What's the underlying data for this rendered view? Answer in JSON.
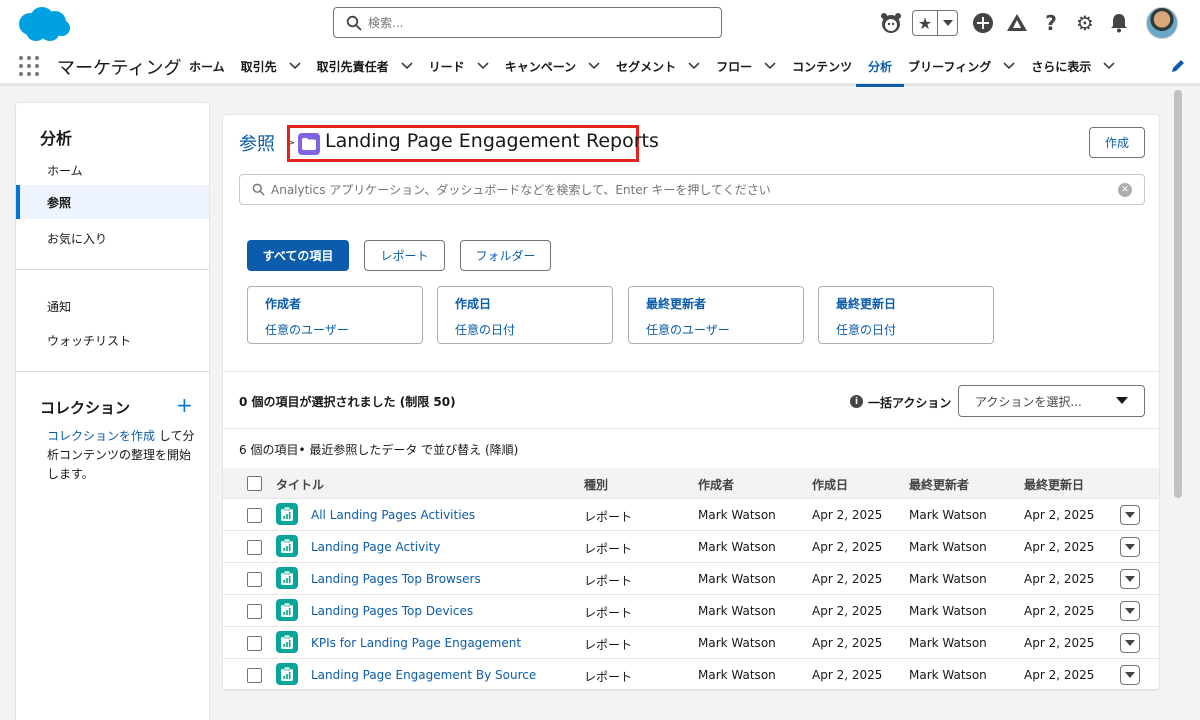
{
  "header": {
    "search_placeholder": "検索...",
    "icons": [
      "einstein-icon",
      "favorites-star-icon",
      "add-icon",
      "trailhead-icon",
      "help-icon",
      "setup-gear-icon",
      "notification-bell-icon"
    ]
  },
  "nav": {
    "app_name": "マーケティング",
    "items": [
      {
        "label": "ホーム",
        "dropdown": false
      },
      {
        "label": "取引先",
        "dropdown": true
      },
      {
        "label": "取引先責任者",
        "dropdown": true
      },
      {
        "label": "リード",
        "dropdown": true
      },
      {
        "label": "キャンペーン",
        "dropdown": true
      },
      {
        "label": "セグメント",
        "dropdown": true
      },
      {
        "label": "フロー",
        "dropdown": true
      },
      {
        "label": "コンテンツ",
        "dropdown": false
      },
      {
        "label": "分析",
        "dropdown": false,
        "active": true
      },
      {
        "label": "ブリーフィング",
        "dropdown": true
      },
      {
        "label": "さらに表示",
        "dropdown": true
      }
    ]
  },
  "sidebar": {
    "title": "分析",
    "items": [
      {
        "label": "ホーム"
      },
      {
        "label": "参照",
        "selected": true
      },
      {
        "label": "お気に入り"
      },
      {
        "label": "通知"
      },
      {
        "label": "ウォッチリスト"
      }
    ],
    "collections": {
      "title": "コレクション",
      "link_text": "コレクションを作成",
      "text": "して分析コンテンツの整理を開始します。"
    }
  },
  "main": {
    "breadcrumb": "参照",
    "folder_title": "Landing Page Engagement Reports",
    "create_label": "作成",
    "search_placeholder": "Analytics アプリケーション、ダッシュボードなどを検索して、Enter キーを押してください",
    "filter_buttons": [
      "すべての項目",
      "レポート",
      "フォルダー"
    ],
    "filter_cards": [
      {
        "title": "作成者",
        "value": "任意のユーザー"
      },
      {
        "title": "作成日",
        "value": "任意の日付"
      },
      {
        "title": "最終更新者",
        "value": "任意のユーザー"
      },
      {
        "title": "最終更新日",
        "value": "任意の日付"
      }
    ],
    "selection_status": "0 個の項目が選択されました (制限 50)",
    "bulk_action_label": "一括アクション",
    "action_select_placeholder": "アクションを選択...",
    "sort_info": "6 個の項目• 最近参照したデータ で並び替え (降順)",
    "table": {
      "columns": [
        "タイトル",
        "種別",
        "作成者",
        "作成日",
        "最終更新者",
        "最終更新日"
      ],
      "rows": [
        {
          "title": "All Landing Pages Activities",
          "type": "レポート",
          "created_by": "Mark Watson",
          "created_date": "Apr 2, 2025",
          "modified_by": "Mark Watson",
          "modified_date": "Apr 2, 2025"
        },
        {
          "title": "Landing Page Activity",
          "type": "レポート",
          "created_by": "Mark Watson",
          "created_date": "Apr 2, 2025",
          "modified_by": "Mark Watson",
          "modified_date": "Apr 2, 2025"
        },
        {
          "title": "Landing Pages Top Browsers",
          "type": "レポート",
          "created_by": "Mark Watson",
          "created_date": "Apr 2, 2025",
          "modified_by": "Mark Watson",
          "modified_date": "Apr 2, 2025"
        },
        {
          "title": "Landing Pages Top Devices",
          "type": "レポート",
          "created_by": "Mark Watson",
          "created_date": "Apr 2, 2025",
          "modified_by": "Mark Watson",
          "modified_date": "Apr 2, 2025"
        },
        {
          "title": "KPIs for Landing Page Engagement",
          "type": "レポート",
          "created_by": "Mark Watson",
          "created_date": "Apr 2, 2025",
          "modified_by": "Mark Watson",
          "modified_date": "Apr 2, 2025"
        },
        {
          "title": "Landing Page Engagement By Source",
          "type": "レポート",
          "created_by": "Mark Watson",
          "created_date": "Apr 2, 2025",
          "modified_by": "Mark Watson",
          "modified_date": "Apr 2, 2025"
        }
      ]
    }
  },
  "colors": {
    "brand_blue": "#0b5cab",
    "highlight_red": "#e3231e",
    "folder_purple": "#7f63e2",
    "report_teal": "#06a59a"
  }
}
